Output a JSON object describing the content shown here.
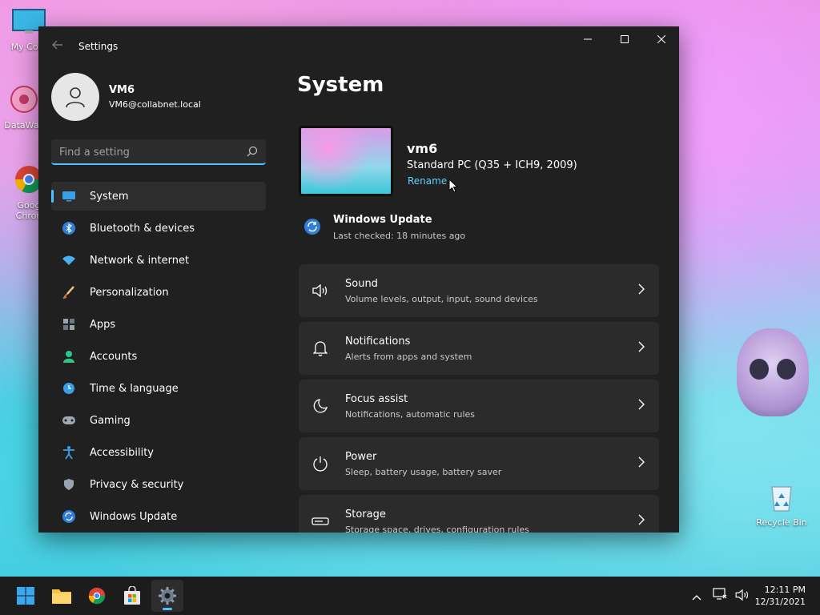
{
  "desktop": {
    "icons": [
      {
        "label": "My Com"
      },
      {
        "label": "DataWac"
      },
      {
        "label": "Goog Chron"
      },
      {
        "label": "Recycle Bin"
      }
    ]
  },
  "window": {
    "title": "Settings",
    "back_icon": "back-arrow-icon",
    "controls": [
      "minimize-icon",
      "maximize-icon",
      "close-icon"
    ]
  },
  "profile": {
    "name": "VM6",
    "email": "VM6@collabnet.local"
  },
  "search": {
    "placeholder": "Find a setting",
    "value": ""
  },
  "sidebar": {
    "items": [
      {
        "label": "System",
        "icon": "monitor-icon",
        "active": true
      },
      {
        "label": "Bluetooth & devices",
        "icon": "bluetooth-icon"
      },
      {
        "label": "Network & internet",
        "icon": "wifi-icon"
      },
      {
        "label": "Personalization",
        "icon": "brush-icon"
      },
      {
        "label": "Apps",
        "icon": "apps-icon"
      },
      {
        "label": "Accounts",
        "icon": "person-icon"
      },
      {
        "label": "Time & language",
        "icon": "globe-clock-icon"
      },
      {
        "label": "Gaming",
        "icon": "gamepad-icon"
      },
      {
        "label": "Accessibility",
        "icon": "accessibility-icon"
      },
      {
        "label": "Privacy & security",
        "icon": "shield-icon"
      },
      {
        "label": "Windows Update",
        "icon": "update-icon"
      }
    ]
  },
  "main": {
    "page_title": "System",
    "device": {
      "name": "vm6",
      "spec": "Standard PC (Q35 + ICH9, 2009)",
      "rename_label": "Rename"
    },
    "windows_update": {
      "title": "Windows Update",
      "subtitle": "Last checked: 18 minutes ago"
    },
    "cards": [
      {
        "title": "Sound",
        "subtitle": "Volume levels, output, input, sound devices",
        "icon": "speaker-icon"
      },
      {
        "title": "Notifications",
        "subtitle": "Alerts from apps and system",
        "icon": "bell-icon"
      },
      {
        "title": "Focus assist",
        "subtitle": "Notifications, automatic rules",
        "icon": "moon-icon"
      },
      {
        "title": "Power",
        "subtitle": "Sleep, battery usage, battery saver",
        "icon": "power-icon"
      },
      {
        "title": "Storage",
        "subtitle": "Storage space, drives, configuration rules",
        "icon": "storage-icon"
      }
    ]
  },
  "taskbar": {
    "apps": [
      "start-icon",
      "file-explorer-icon",
      "chrome-icon",
      "store-icon",
      "settings-icon"
    ],
    "active_app": "settings-icon",
    "time": "12:11 PM",
    "date": "12/31/2021"
  },
  "colors": {
    "accent": "#4cc2ff",
    "link": "#60cdff",
    "window_bg": "#202020",
    "card_bg": "#2b2b2b",
    "taskbar_bg": "#1c1c1c"
  }
}
